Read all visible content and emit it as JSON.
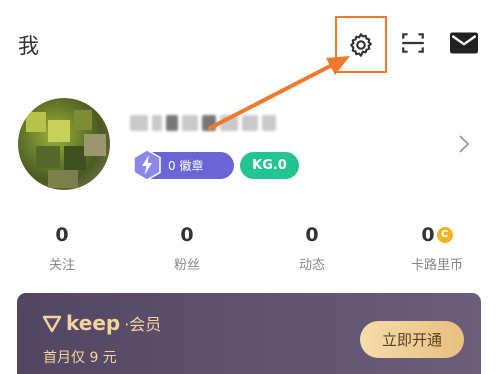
{
  "header": {
    "title": "我"
  },
  "icons": {
    "settings": "gear-icon",
    "scan": "scan-icon",
    "mail": "mail-icon",
    "chevron": "chevron-right-icon",
    "badge": "lightning-hexagon-icon"
  },
  "profile": {
    "badge_label": "0 徽章",
    "kg_label": "KG.0"
  },
  "stats": [
    {
      "value": "0",
      "label": "关注"
    },
    {
      "value": "0",
      "label": "粉丝"
    },
    {
      "value": "0",
      "label": "动态"
    },
    {
      "value": "0",
      "label": "卡路里币",
      "coin": "C"
    }
  ],
  "vip": {
    "logo_text": "keep",
    "member_text": "·会员",
    "subtitle": "首月仅 9 元",
    "button": "立即开通"
  },
  "colors": {
    "highlight": "#f07a2c",
    "badge": "#6a64d4",
    "kg": "#23c493",
    "vip_bg": "#524662",
    "vip_gold": "#f4d49d"
  }
}
